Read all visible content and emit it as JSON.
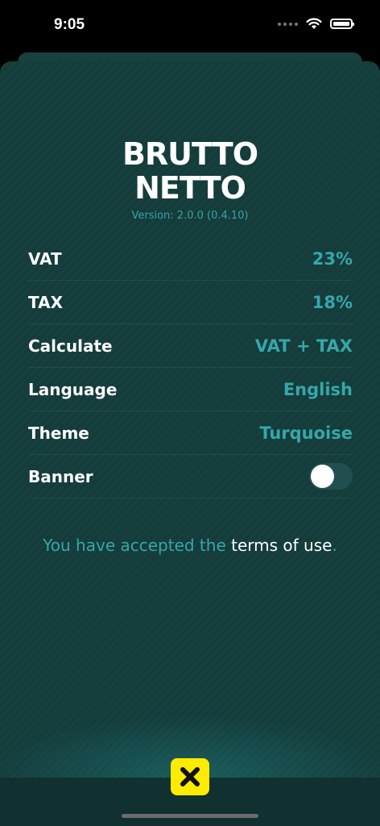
{
  "status_bar": {
    "time": "9:05"
  },
  "app": {
    "title_line1": "BRUTTO",
    "title_line2": "NETTO",
    "version": "Version: 2.0.0 (0.4.10)"
  },
  "settings": {
    "rows": [
      {
        "label": "VAT",
        "value": "23%"
      },
      {
        "label": "TAX",
        "value": "18%"
      },
      {
        "label": "Calculate",
        "value": "VAT + TAX"
      },
      {
        "label": "Language",
        "value": "English"
      },
      {
        "label": "Theme",
        "value": "Turquoise"
      }
    ],
    "banner": {
      "label": "Banner",
      "enabled": false
    }
  },
  "terms": {
    "prefix": "You have accepted the ",
    "link": "terms of use",
    "suffix": "."
  },
  "close_button": {
    "icon": "close-icon",
    "color": "#ffeb00"
  },
  "colors": {
    "accent": "#36a7aa",
    "background": "#133c3b"
  }
}
